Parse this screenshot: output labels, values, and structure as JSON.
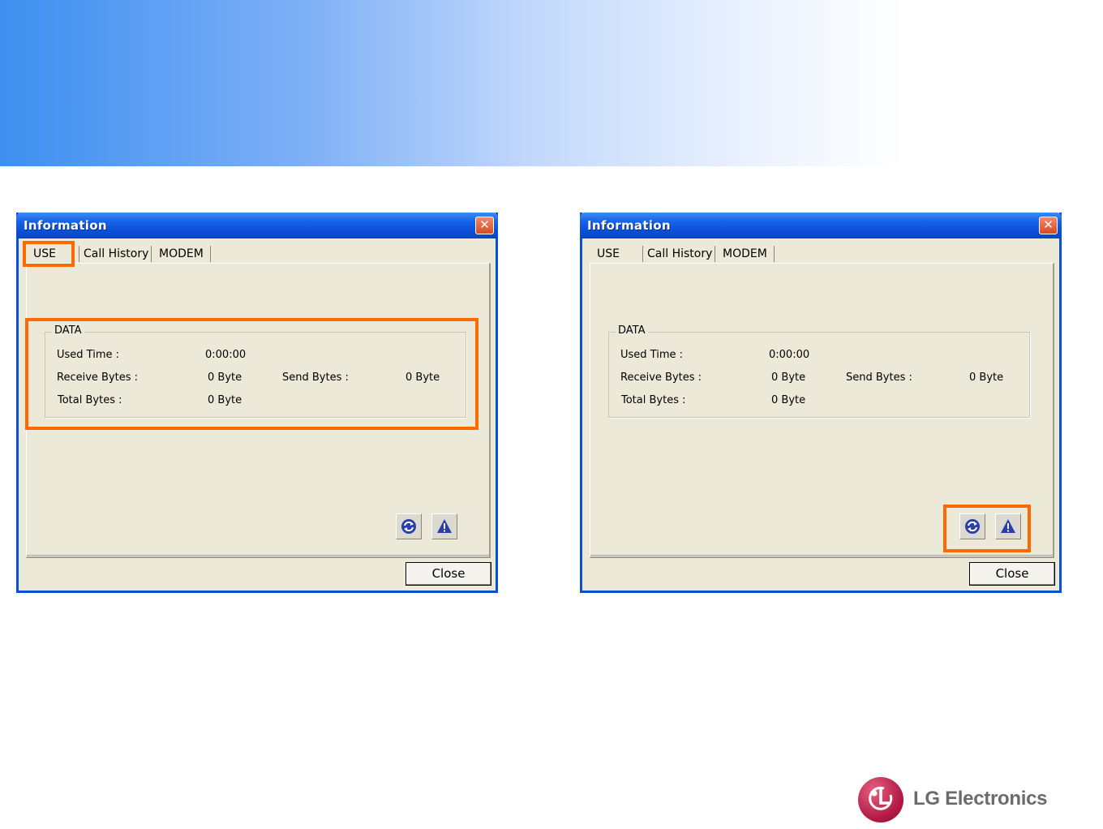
{
  "windows": [
    {
      "title": "Information",
      "close_glyph": "✕",
      "tabs": [
        "USE",
        "Call History",
        "MODEM"
      ],
      "group_label": "DATA",
      "used_time_label": "Used Time :",
      "used_time_value": "0:00:00",
      "receive_label": "Receive Bytes :",
      "receive_value": "0 Byte",
      "send_label": "Send Bytes :",
      "send_value": "0 Byte",
      "total_label": "Total Bytes :",
      "total_value": "0 Byte",
      "close_label": "Close",
      "icons": [
        "refresh-icon",
        "warning-icon"
      ],
      "highlighted": [
        "use-tab",
        "data-group"
      ]
    },
    {
      "title": "Information",
      "close_glyph": "✕",
      "tabs": [
        "USE",
        "Call History",
        "MODEM"
      ],
      "group_label": "DATA",
      "used_time_label": "Used Time :",
      "used_time_value": "0:00:00",
      "receive_label": "Receive Bytes :",
      "receive_value": "0 Byte",
      "send_label": "Send Bytes :",
      "send_value": "0 Byte",
      "total_label": "Total Bytes :",
      "total_value": "0 Byte",
      "close_label": "Close",
      "icons": [
        "refresh-icon",
        "warning-icon"
      ],
      "highlighted": [
        "icon-buttons"
      ]
    }
  ],
  "highlight_color": "#ff6a00",
  "logo": {
    "text": "LG Electronics",
    "color": "#b11a44"
  }
}
